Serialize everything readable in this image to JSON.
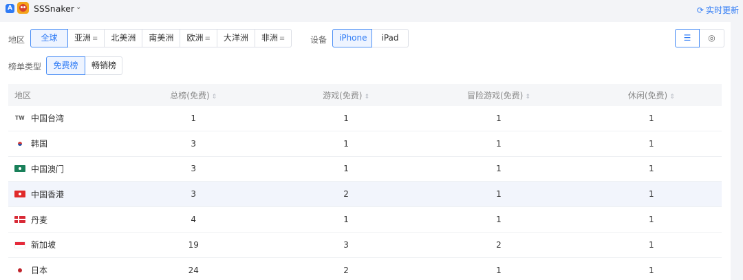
{
  "app": {
    "store_icon": "A",
    "name": "SSSnaker",
    "chevron": "⌄",
    "realtime_label": "实时更新"
  },
  "filters": {
    "region_label": "地区",
    "regions": [
      {
        "label": "全球",
        "active": true,
        "menu": false
      },
      {
        "label": "亚洲",
        "active": false,
        "menu": true
      },
      {
        "label": "北美洲",
        "active": false,
        "menu": false
      },
      {
        "label": "南美洲",
        "active": false,
        "menu": false
      },
      {
        "label": "欧洲",
        "active": false,
        "menu": true
      },
      {
        "label": "大洋洲",
        "active": false,
        "menu": false
      },
      {
        "label": "非洲",
        "active": false,
        "menu": true
      }
    ],
    "device_label": "设备",
    "devices": [
      {
        "label": "iPhone",
        "active": true
      },
      {
        "label": "iPad",
        "active": false
      }
    ],
    "chart_type_label": "榜单类型",
    "chart_types": [
      {
        "label": "免费榜",
        "active": true
      },
      {
        "label": "畅销榜",
        "active": false
      }
    ]
  },
  "table": {
    "headers": [
      "地区",
      "总榜(免费)",
      "游戏(免费)",
      "冒险游戏(免费)",
      "休闲(免费)"
    ],
    "rows": [
      {
        "flag": "tw",
        "flag_text": "TW",
        "region": "中国台湾",
        "overall": "1",
        "games": "1",
        "adventure": "1",
        "casual": "1"
      },
      {
        "flag": "kr",
        "flag_text": "",
        "region": "韩国",
        "overall": "3",
        "games": "1",
        "adventure": "1",
        "casual": "1"
      },
      {
        "flag": "mo",
        "flag_text": "",
        "region": "中国澳门",
        "overall": "3",
        "games": "1",
        "adventure": "1",
        "casual": "1"
      },
      {
        "flag": "hk",
        "flag_text": "",
        "region": "中国香港",
        "overall": "3",
        "games": "2",
        "adventure": "1",
        "casual": "1"
      },
      {
        "flag": "dk",
        "flag_text": "",
        "region": "丹麦",
        "overall": "4",
        "games": "1",
        "adventure": "1",
        "casual": "1"
      },
      {
        "flag": "sg",
        "flag_text": "",
        "region": "新加坡",
        "overall": "19",
        "games": "3",
        "adventure": "2",
        "casual": "1"
      },
      {
        "flag": "jp",
        "flag_text": "",
        "region": "日本",
        "overall": "24",
        "games": "2",
        "adventure": "1",
        "casual": "1"
      }
    ]
  },
  "colors": {
    "accent": "#2f7bf5",
    "highlight_row": "#f2f5fc"
  }
}
